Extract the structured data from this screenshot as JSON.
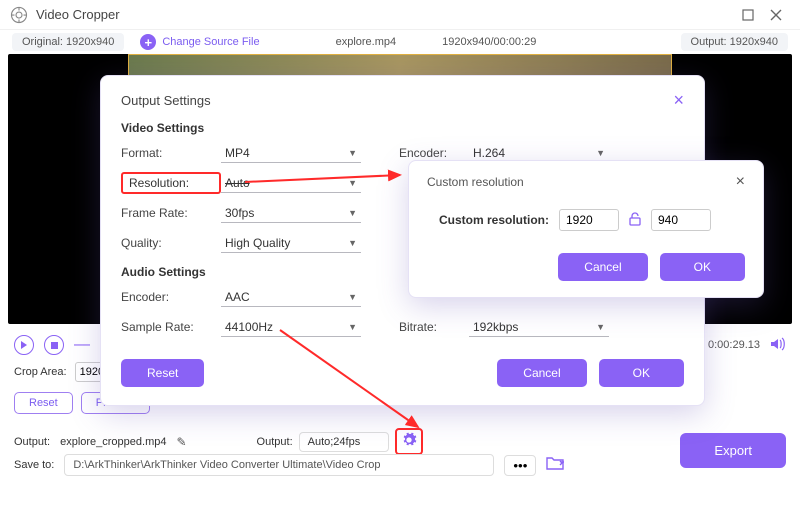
{
  "title": "Video Cropper",
  "infobar": {
    "original": "Original: 1920x940",
    "change_source": "Change Source File",
    "filename": "explore.mp4",
    "dims_time": "1920x940/00:00:29",
    "output": "Output: 1920x940"
  },
  "play": {
    "time": "0:00:29.13"
  },
  "crop": {
    "label": "Crop Area:",
    "w": "1920"
  },
  "btns": {
    "reset": "Reset",
    "preview": "Preview"
  },
  "output1": {
    "label": "Output:",
    "filename": "explore_cropped.mp4",
    "label2": "Output:",
    "value": "Auto;24fps"
  },
  "saveto": {
    "label": "Save to:",
    "path": "D:\\ArkThinker\\ArkThinker Video Converter Ultimate\\Video Crop"
  },
  "export": "Export",
  "modal": {
    "title": "Output Settings",
    "video_settings": "Video Settings",
    "audio_settings": "Audio Settings",
    "format_label": "Format:",
    "format": "MP4",
    "resolution_label": "Resolution:",
    "resolution": "Auto",
    "framerate_label": "Frame Rate:",
    "framerate": "30fps",
    "quality_label": "Quality:",
    "quality": "High Quality",
    "encoder_label": "Encoder:",
    "video_encoder": "H.264",
    "audio_encoder": "AAC",
    "sample_label": "Sample Rate:",
    "sample": "44100Hz",
    "bitrate_label": "Bitrate:",
    "bitrate": "192kbps",
    "reset": "Reset",
    "cancel": "Cancel",
    "ok": "OK"
  },
  "sub_modal": {
    "title": "Custom resolution",
    "label": "Custom resolution:",
    "w": "1920",
    "h": "940",
    "cancel": "Cancel",
    "ok": "OK"
  }
}
